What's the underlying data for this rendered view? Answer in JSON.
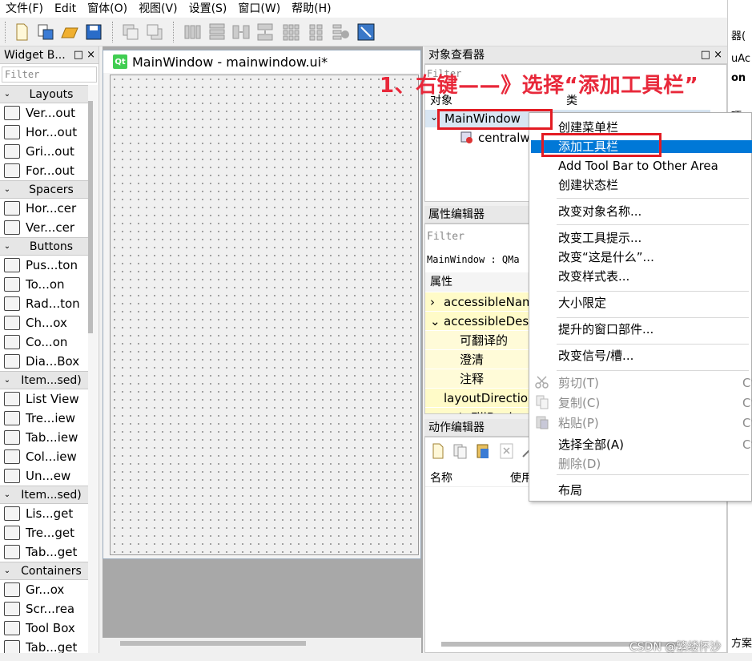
{
  "menubar": [
    "文件(F)",
    "Edit",
    "窗体(O)",
    "视图(V)",
    "设置(S)",
    "窗口(W)",
    "帮助(H)"
  ],
  "toolbar_icons": [
    "new-file-icon",
    "open-file-icon",
    "open-folder-icon",
    "save-icon",
    "bring-front-icon",
    "send-back-icon",
    "layout-horizontal-icon",
    "layout-vertical-icon",
    "splitter-horizontal-icon",
    "splitter-vertical-icon",
    "layout-grid-icon",
    "layout-form-icon",
    "break-layout-icon",
    "adjust-size-icon"
  ],
  "widget_box": {
    "title": "Widget B...",
    "title_buttons": "□ ×",
    "filter_placeholder": "Filter",
    "categories": [
      {
        "label": "Layouts",
        "items": [
          "Ver...out",
          "Hor...out",
          "Gri...out",
          "For...out"
        ]
      },
      {
        "label": "Spacers",
        "items": [
          "Hor...cer",
          "Ver...cer"
        ]
      },
      {
        "label": "Buttons",
        "items": [
          "Pus...ton",
          "To...on",
          "Rad...ton",
          "Ch...ox",
          "Co...on",
          "Dia...Box"
        ]
      },
      {
        "label": "Item...sed)",
        "items": [
          "List View",
          "Tre...iew",
          "Tab...iew",
          "Col...iew",
          "Un...ew"
        ]
      },
      {
        "label": "Item...sed)",
        "items": [
          "Lis...get",
          "Tre...get",
          "Tab...get"
        ]
      },
      {
        "label": "Containers",
        "items": [
          "Gr...ox",
          "Scr...rea",
          "Tool Box",
          "Tab...get"
        ]
      }
    ]
  },
  "form_window": {
    "badge": "Qt",
    "title": "MainWindow - mainwindow.ui*"
  },
  "object_inspector": {
    "title": "对象查看器",
    "filter": "Filter",
    "col_object": "对象",
    "col_class": "类",
    "root": "MainWindow",
    "child": "centralw"
  },
  "property_editor": {
    "title": "属性编辑器",
    "filter": "Filter",
    "class_line": "MainWindow : QMa",
    "header": "属性",
    "rows": [
      {
        "label": "accessibleNam",
        "indent": 1,
        "arrow": "›"
      },
      {
        "label": "accessibleDesc",
        "indent": 1,
        "arrow": "⌄"
      },
      {
        "label": "可翻译的",
        "indent": 2,
        "arrow": ""
      },
      {
        "label": "澄清",
        "indent": 2,
        "arrow": ""
      },
      {
        "label": "注释",
        "indent": 2,
        "arrow": ""
      },
      {
        "label": "layoutDirection",
        "indent": 1,
        "arrow": ""
      },
      {
        "label": "autoFillBack",
        "indent": 1,
        "arrow": ""
      }
    ]
  },
  "action_editor": {
    "title": "动作编辑器",
    "col_name": "名称",
    "col_used": "使用"
  },
  "context_menu": {
    "items": [
      {
        "label": "创建菜单栏",
        "shortcut": "",
        "disabled": false,
        "highlighted": false
      },
      {
        "label": "添加工具栏",
        "shortcut": "",
        "disabled": false,
        "highlighted": true
      },
      {
        "label": "Add Tool Bar to Other Area",
        "shortcut": "",
        "disabled": false,
        "highlighted": false
      },
      {
        "label": "创建状态栏",
        "shortcut": "",
        "disabled": false,
        "highlighted": false
      },
      {
        "label": "改变对象名称...",
        "shortcut": "",
        "disabled": false,
        "highlighted": false
      },
      {
        "label": "改变工具提示...",
        "shortcut": "",
        "disabled": false,
        "highlighted": false
      },
      {
        "label": "改变“这是什么”...",
        "shortcut": "",
        "disabled": false,
        "highlighted": false
      },
      {
        "label": "改变样式表...",
        "shortcut": "",
        "disabled": false,
        "highlighted": false
      },
      {
        "label": "大小限定",
        "shortcut": "",
        "disabled": false,
        "highlighted": false
      },
      {
        "label": "提升的窗口部件...",
        "shortcut": "",
        "disabled": false,
        "highlighted": false
      },
      {
        "label": "改变信号/槽...",
        "shortcut": "",
        "disabled": false,
        "highlighted": false
      },
      {
        "label": "剪切(T)",
        "shortcut": "Ct",
        "disabled": true,
        "highlighted": false
      },
      {
        "label": "复制(C)",
        "shortcut": "Ct",
        "disabled": true,
        "highlighted": false
      },
      {
        "label": "粘贴(P)",
        "shortcut": "Ct",
        "disabled": true,
        "highlighted": false
      },
      {
        "label": "选择全部(A)",
        "shortcut": "Ct",
        "disabled": false,
        "highlighted": false
      },
      {
        "label": "删除(D)",
        "shortcut": "",
        "disabled": true,
        "highlighted": false
      },
      {
        "label": "布局",
        "shortcut": "",
        "disabled": false,
        "highlighted": false
      }
    ]
  },
  "annotation": {
    "text": "1、右键——》选择“添加工具栏”",
    "color": "#e31b23"
  },
  "background_window": {
    "lines": [
      "器(",
      "uAc",
      "on",
      "项",
      "方案"
    ]
  },
  "watermark": "CSDN @繁缕怀沙",
  "colors": {
    "highlight": "#0078d7",
    "property_yellow": "#fffbc8",
    "selection_blue": "#d8e6f3"
  }
}
